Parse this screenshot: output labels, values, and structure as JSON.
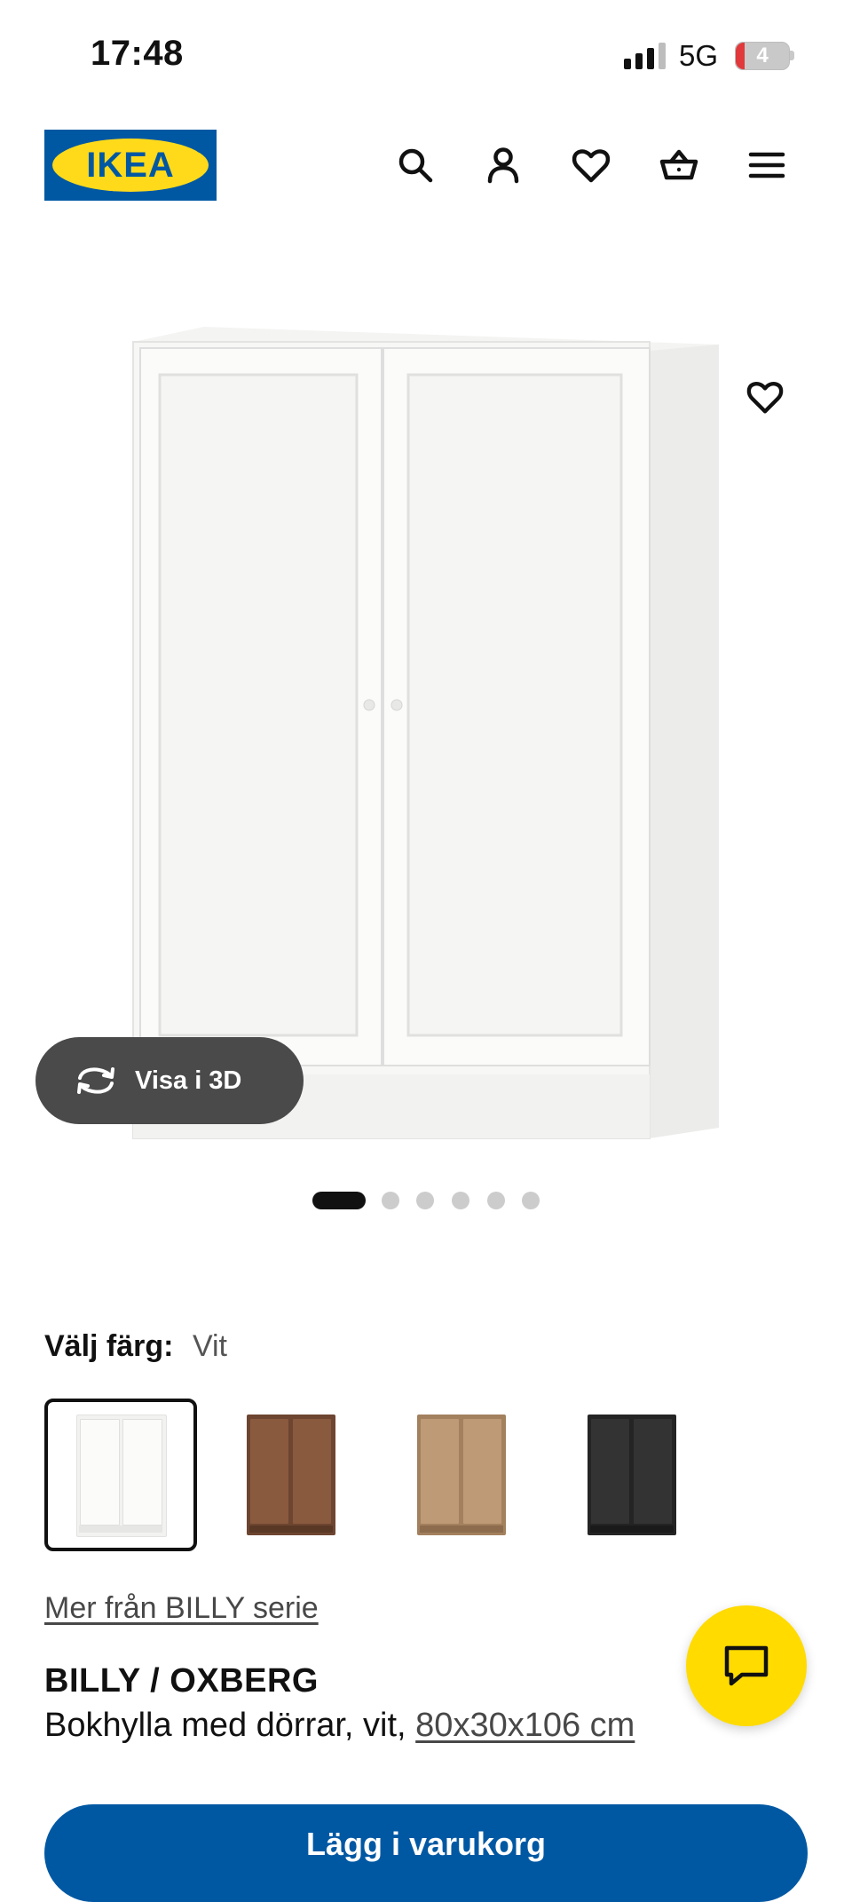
{
  "status_bar": {
    "time": "17:48",
    "network": "5G",
    "battery": "4",
    "battery_level": 0.04,
    "signal_bars": 3
  },
  "header": {
    "logo_text": "IKEA",
    "icons": [
      "search-icon",
      "account-icon",
      "heart-icon",
      "basket-icon",
      "menu-icon"
    ]
  },
  "gallery": {
    "view_3d_label": "Visa i 3D",
    "current_image": 1,
    "image_count": 6
  },
  "color_selector": {
    "label": "Välj färg:",
    "selected_value": "Vit",
    "options": [
      {
        "name": "white",
        "body": "#f2f2f0",
        "door": "#fbfbfa",
        "plinth": "#e6e6e4"
      },
      {
        "name": "brown-walnut",
        "body": "#6d4530",
        "door": "#8a5a3e",
        "plinth": "#5a3826"
      },
      {
        "name": "oak-effect",
        "body": "#a3805e",
        "door": "#bf9a76",
        "plinth": "#8c6c4c"
      },
      {
        "name": "black-brown",
        "body": "#242424",
        "door": "#333333",
        "plinth": "#1a1a1a"
      }
    ],
    "selected_index": 0
  },
  "product": {
    "series_link": "Mer från BILLY serie",
    "name": "BILLY / OXBERG",
    "description": "Bokhylla med dörrar, vit, ",
    "dimensions": "80x30x106 cm"
  },
  "primary_button": {
    "label": "Lägg i varukorg"
  },
  "colors": {
    "ikea_blue": "#0058a3",
    "ikea_yellow": "#ffda1a",
    "chat_yellow": "#ffdb00"
  }
}
